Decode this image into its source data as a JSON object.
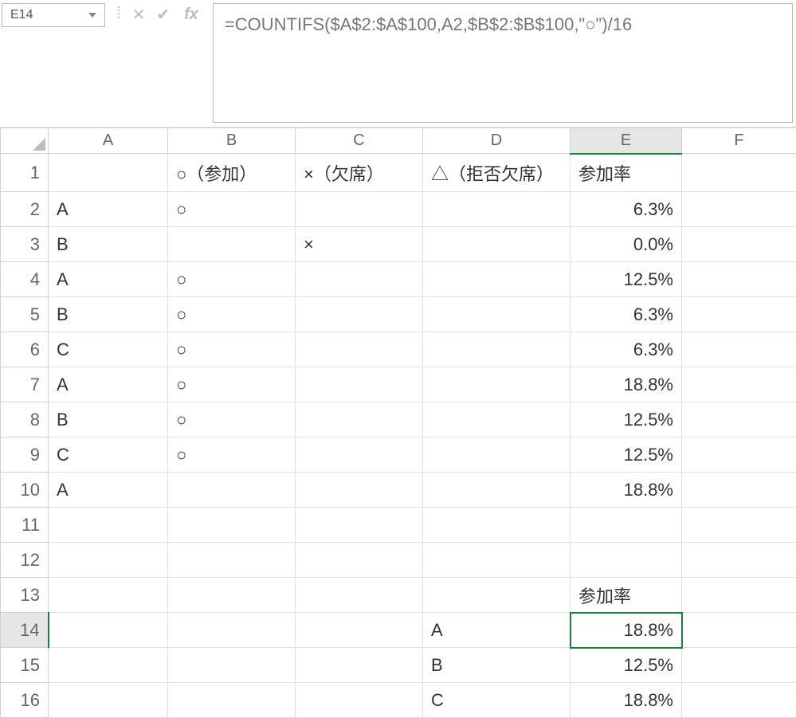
{
  "namebox": "E14",
  "formula": "=COUNTIFS($A$2:$A$100,A2,$B$2:$B$100,\"○\")/16",
  "columns": [
    "A",
    "B",
    "C",
    "D",
    "E",
    "F"
  ],
  "selected_col": "E",
  "selected_row": 14,
  "rows": [
    {
      "n": 1,
      "A": "",
      "B": "○（参加）",
      "C": "×（欠席）",
      "D": "△（拒否欠席）",
      "E": "参加率"
    },
    {
      "n": 2,
      "A": "A",
      "B": "○",
      "C": "",
      "D": "",
      "E": "6.3%"
    },
    {
      "n": 3,
      "A": "B",
      "B": "",
      "C": "×",
      "D": "",
      "E": "0.0%"
    },
    {
      "n": 4,
      "A": "A",
      "B": "○",
      "C": "",
      "D": "",
      "E": "12.5%"
    },
    {
      "n": 5,
      "A": "B",
      "B": "○",
      "C": "",
      "D": "",
      "E": "6.3%"
    },
    {
      "n": 6,
      "A": "C",
      "B": "○",
      "C": "",
      "D": "",
      "E": "6.3%"
    },
    {
      "n": 7,
      "A": "A",
      "B": "○",
      "C": "",
      "D": "",
      "E": "18.8%"
    },
    {
      "n": 8,
      "A": "B",
      "B": "○",
      "C": "",
      "D": "",
      "E": "12.5%"
    },
    {
      "n": 9,
      "A": "C",
      "B": "○",
      "C": "",
      "D": "",
      "E": "12.5%"
    },
    {
      "n": 10,
      "A": "A",
      "B": "",
      "C": "",
      "D": "",
      "E": "18.8%"
    },
    {
      "n": 11,
      "A": "",
      "B": "",
      "C": "",
      "D": "",
      "E": ""
    },
    {
      "n": 12,
      "A": "",
      "B": "",
      "C": "",
      "D": "",
      "E": ""
    },
    {
      "n": 13,
      "A": "",
      "B": "",
      "C": "",
      "D": "",
      "E": "参加率"
    },
    {
      "n": 14,
      "A": "",
      "B": "",
      "C": "",
      "D": "A",
      "E": "18.8%"
    },
    {
      "n": 15,
      "A": "",
      "B": "",
      "C": "",
      "D": "B",
      "E": "12.5%"
    },
    {
      "n": 16,
      "A": "",
      "B": "",
      "C": "",
      "D": "C",
      "E": "18.8%"
    }
  ]
}
